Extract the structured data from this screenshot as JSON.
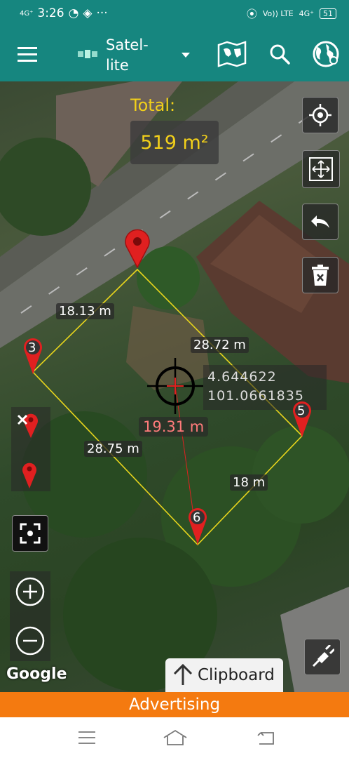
{
  "status_bar": {
    "network": "4G⁺",
    "time": "3:26",
    "dots": "···",
    "volte": "Vo)) LTE",
    "net_right": "4G⁺",
    "battery": "51"
  },
  "toolbar": {
    "map_type": "Satel-\nlite",
    "icons": [
      "menu-icon",
      "satellite-icon",
      "dropdown-icon",
      "map-icon",
      "search-icon",
      "globe-icon"
    ]
  },
  "measure": {
    "total_label": "Total:",
    "total_value": "519  m²"
  },
  "segments": {
    "a": "18.13 m",
    "b": "28.72 m",
    "c": "28.75 m",
    "d": "18 m"
  },
  "cursor": {
    "lat": "4.644622",
    "lon": "101.0661835",
    "distance": "19.31 m"
  },
  "markers": {
    "m3": "3",
    "m5": "5",
    "m6": "6"
  },
  "attribution": "Google",
  "clipboard_label": "Clipboard",
  "ad_label": "Advertising",
  "colors": {
    "toolbar": "#16867f",
    "polygon": "#e8d51c",
    "marker": "#e02020",
    "ad": "#f47a10"
  }
}
